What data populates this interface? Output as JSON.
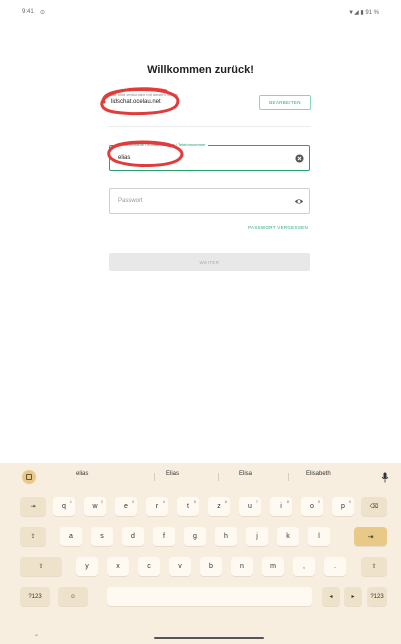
{
  "status_bar": {
    "time": "9:41",
    "indicator": "⊙",
    "right_icons": "▼◢ ▮ 91 %"
  },
  "title": "Willkommen zurück!",
  "server": {
    "hint": "Sie sind verbunden mit diesem Server",
    "value": "lidschat.ocelau.net",
    "edit_label": "BEARBEITEN"
  },
  "username_field": {
    "label": "Benutzername / E-Mail-Adresse / Telefonnummer",
    "value": "elias",
    "clear_icon": "clear-circle-icon"
  },
  "password_field": {
    "placeholder": "Passwort",
    "toggle_icon": "eye-icon"
  },
  "forgot_password": "PASSWORT VERGESSEN",
  "next_button": "WEITER",
  "colors": {
    "accent": "#26a371",
    "annotation": "#e23b3b",
    "keyboard_bg": "#f7eedf",
    "enter_key": "#e9c987"
  },
  "keyboard": {
    "suggestions": [
      "elias",
      "Elias",
      "Elisa",
      "Elisabeth"
    ],
    "row1": [
      "q",
      "w",
      "e",
      "r",
      "t",
      "z",
      "u",
      "i",
      "o",
      "p"
    ],
    "row1_hints": [
      "1",
      "2",
      "3",
      "4",
      "5",
      "6",
      "7",
      "8",
      "9",
      "0"
    ],
    "row2": [
      "a",
      "s",
      "d",
      "f",
      "g",
      "h",
      "j",
      "k",
      "l"
    ],
    "row3": [
      "y",
      "x",
      "c",
      "v",
      "b",
      "n",
      "m",
      ",",
      "."
    ],
    "tab_key": "⇥",
    "backspace_key": "⌫",
    "caps_key": "⇪",
    "enter_key": "⇥",
    "shift_key": "⇧",
    "symbols_key": "?123",
    "emoji_key": "☺",
    "left_arrow": "◂",
    "right_arrow": "▸",
    "nav_down": "⌄"
  }
}
